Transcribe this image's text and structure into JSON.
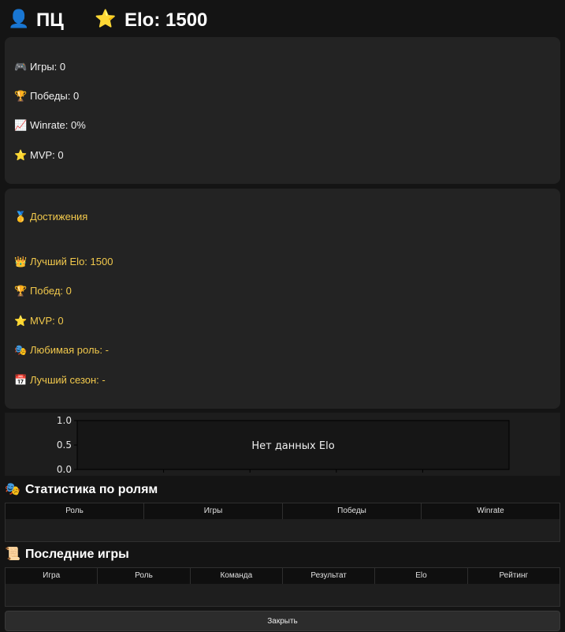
{
  "header": {
    "user_icon": "👤",
    "name": "ПЦ",
    "elo_icon": "⭐",
    "elo_text": "Elo: 1500"
  },
  "stats": [
    {
      "icon": "🎮",
      "icon_name": "gamepad-icon",
      "text": "Игры: 0"
    },
    {
      "icon": "🏆",
      "icon_name": "trophy-icon",
      "text": "Победы: 0"
    },
    {
      "icon": "📈",
      "icon_name": "chart-up-icon",
      "text": "Winrate: 0%"
    },
    {
      "icon": "⭐",
      "icon_name": "star-icon",
      "text": "MVP: 0"
    }
  ],
  "achievements": {
    "title_icon": "🥇",
    "title": "Достижения",
    "items": [
      {
        "icon": "👑",
        "icon_name": "crown-icon",
        "text": "Лучший Elo: 1500"
      },
      {
        "icon": "🏆",
        "icon_name": "trophy-icon",
        "text": "Побед: 0"
      },
      {
        "icon": "⭐",
        "icon_name": "star-icon",
        "text": "MVP: 0"
      },
      {
        "icon": "🎭",
        "icon_name": "theater-masks-icon",
        "text": "Любимая роль: -"
      },
      {
        "icon": "📅",
        "icon_name": "calendar-icon",
        "text": "Лучший сезон: -"
      }
    ]
  },
  "chart_data": {
    "type": "line",
    "x": [],
    "values": [],
    "yticks": [
      "1.0",
      "0.5",
      "0.0"
    ],
    "ylim": [
      0.0,
      1.0
    ],
    "annotation": "Нет данных Elo",
    "title": "",
    "xlabel": "",
    "ylabel": ""
  },
  "roles_section": {
    "icon": "🎭",
    "title": "Статистика по ролям",
    "columns": [
      "Роль",
      "Игры",
      "Победы",
      "Winrate"
    ]
  },
  "games_section": {
    "icon": "📜",
    "title": "Последние игры",
    "columns": [
      "Игра",
      "Роль",
      "Команда",
      "Результат",
      "Elo",
      "Рейтинг"
    ]
  },
  "close_label": "Закрыть"
}
